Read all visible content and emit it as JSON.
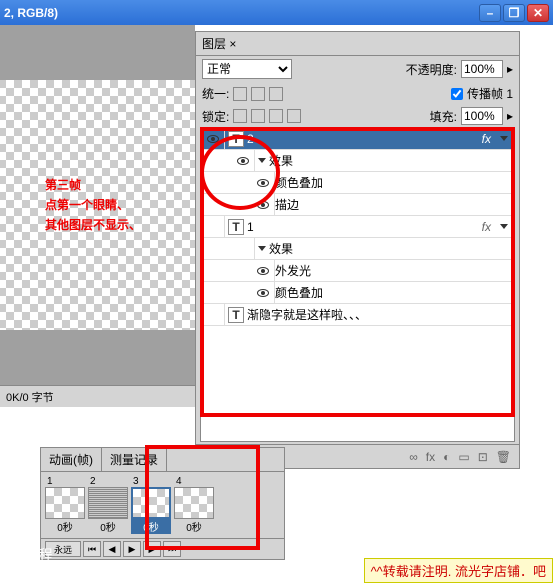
{
  "titlebar": {
    "text": "2, RGB/8)"
  },
  "annotation": {
    "line1": "第三帧",
    "line2": "点第一个眼睛、",
    "line3": "其他图层不显示、"
  },
  "layers": {
    "tab": "图层 ×",
    "blend_mode": "正常",
    "opacity_label": "不透明度:",
    "opacity_value": "100%",
    "unify_label": "统一:",
    "propagate_label": "传播帧 1",
    "lock_label": "锁定:",
    "fill_label": "填充:",
    "fill_value": "100%",
    "items": [
      {
        "name": "2",
        "fx": "fx"
      },
      {
        "name": "效果"
      },
      {
        "name": "颜色叠加"
      },
      {
        "name": "描边"
      },
      {
        "name": "1",
        "fx": "fx"
      },
      {
        "name": "效果"
      },
      {
        "name": "外发光"
      },
      {
        "name": "颜色叠加"
      },
      {
        "name": "渐隐字就是这样啦、、、"
      }
    ],
    "footer_icons": [
      "∞",
      "fx",
      "◐",
      "▭",
      "⊡",
      "🗑"
    ]
  },
  "status": "0K/0 字节",
  "animation": {
    "tab1": "动画(帧)",
    "tab2": "测量记录",
    "frames": [
      {
        "num": "1",
        "time": "0秒"
      },
      {
        "num": "2",
        "time": "0秒"
      },
      {
        "num": "3",
        "time": "0秒"
      },
      {
        "num": "4",
        "time": "0秒"
      }
    ],
    "loop": "永远"
  },
  "watermark": {
    "line1": "PS教程",
    "line2": "BBS.16XX8.COM"
  },
  "credit": "^^转载请注明. 流光字店铺．吧"
}
